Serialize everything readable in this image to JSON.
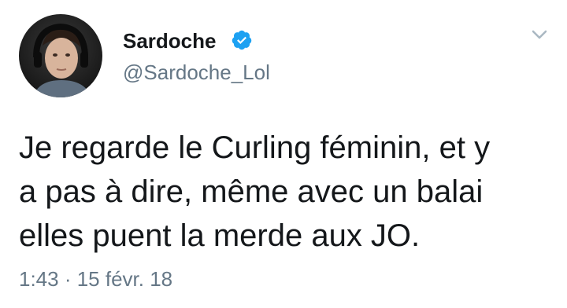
{
  "author": {
    "display_name": "Sardoche",
    "handle": "@Sardoche_Lol",
    "verified": true,
    "avatar_icon": "profile-photo"
  },
  "tweet": {
    "text_lines": [
      "Je regarde le Curling féminin, et y",
      "a pas à dire, même avec un balai",
      "elles puent la merde aux JO."
    ],
    "timestamp": "1:43 · 15 févr. 18"
  },
  "menu": {
    "icon": "chevron-down-icon"
  },
  "colors": {
    "text": "#14171a",
    "secondary": "#657786",
    "verified_blue": "#1da1f2"
  }
}
